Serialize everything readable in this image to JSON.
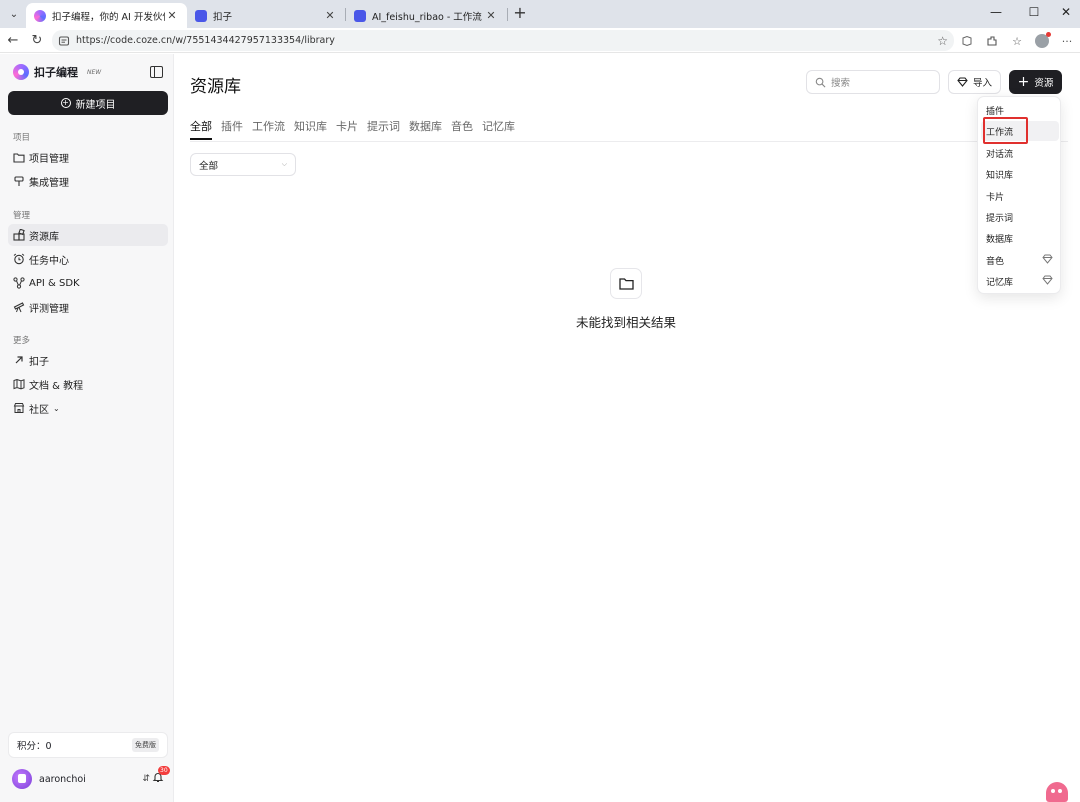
{
  "browser": {
    "tabs": [
      {
        "title": "扣子编程，你的 AI 开发伙伴，Vib",
        "active": true
      },
      {
        "title": "扣子",
        "active": false
      },
      {
        "title": "AI_feishu_ribao - 工作流 -智能体平",
        "active": false
      }
    ],
    "url": "https://code.coze.cn/w/7551434427957133354/library"
  },
  "sidebar": {
    "brand_name": "扣子编程",
    "brand_badge": "NEW",
    "new_project": "新建项目",
    "sections": [
      {
        "label": "项目",
        "items": [
          {
            "label": "项目管理",
            "icon": "folder-icon"
          },
          {
            "label": "集成管理",
            "icon": "integration-icon"
          }
        ]
      },
      {
        "label": "管理",
        "items": [
          {
            "label": "资源库",
            "icon": "library-icon"
          },
          {
            "label": "任务中心",
            "icon": "alarm-icon"
          },
          {
            "label": "API & SDK",
            "icon": "api-icon"
          },
          {
            "label": "评测管理",
            "icon": "telescope-icon"
          }
        ]
      },
      {
        "label": "更多",
        "items": [
          {
            "label": "扣子",
            "icon": "arrow-up-right-icon"
          },
          {
            "label": "文档 & 教程",
            "icon": "map-icon"
          },
          {
            "label": "社区",
            "icon": "store-icon"
          }
        ]
      }
    ],
    "points_label": "积分：0",
    "plan": "免费版",
    "username": "aaronchoi",
    "notification_count": "30"
  },
  "main": {
    "title": "资源库",
    "search_placeholder": "搜索",
    "import_label": "导入",
    "resource_label": "资源",
    "type_tabs": [
      "全部",
      "插件",
      "工作流",
      "知识库",
      "卡片",
      "提示词",
      "数据库",
      "音色",
      "记忆库"
    ],
    "filter_value": "全部",
    "empty_text": "未能找到相关结果"
  },
  "dropdown": {
    "items": [
      {
        "label": "插件",
        "premium": false
      },
      {
        "label": "工作流",
        "premium": false
      },
      {
        "label": "对话流",
        "premium": false
      },
      {
        "label": "知识库",
        "premium": false
      },
      {
        "label": "卡片",
        "premium": false
      },
      {
        "label": "提示词",
        "premium": false
      },
      {
        "label": "数据库",
        "premium": false
      },
      {
        "label": "音色",
        "premium": true
      },
      {
        "label": "记忆库",
        "premium": true
      }
    ]
  },
  "colors": {
    "accent_dark": "#1f1f23",
    "highlight_box": "#e0302e",
    "badge": "#f33d3d"
  }
}
